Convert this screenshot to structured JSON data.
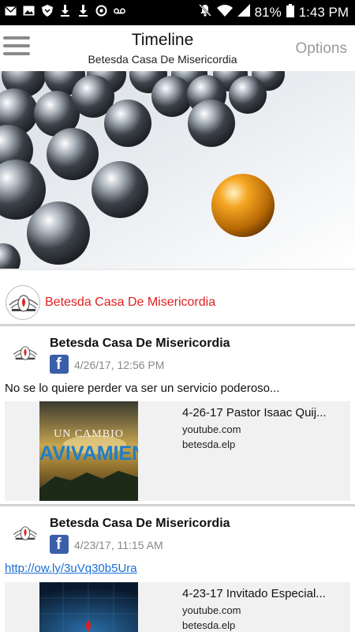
{
  "status_bar": {
    "battery": "81%",
    "time": "1:43 PM"
  },
  "header": {
    "title": "Timeline",
    "subtitle": "Betesda Casa De Misericordia",
    "options_label": "Options"
  },
  "channel": {
    "name": "Betesda Casa De Misericordia"
  },
  "posts": [
    {
      "author": "Betesda Casa De Misericordia",
      "source_icon": "facebook-icon",
      "date": "4/26/17, 12:56 PM",
      "text": "No se lo quiere perder va ser un servicio poderoso...",
      "card": {
        "title": "4-26-17 Pastor Isaac Quij...",
        "host": "youtube.com",
        "user": "betesda.elp",
        "thumb_text_top": "UN CAMBIO",
        "thumb_text_bottom": "AVIVAMIENTO"
      }
    },
    {
      "author": "Betesda Casa De Misericordia",
      "source_icon": "facebook-icon",
      "date": "4/23/17, 11:15 AM",
      "link": "http://ow.ly/3uVq30b5Ura",
      "card": {
        "title": "4-23-17 Invitado Especial...",
        "host": "youtube.com",
        "user": "betesda.elp"
      }
    }
  ],
  "colors": {
    "accent_red": "#e02020",
    "facebook_blue": "#3b5ea8",
    "link_blue": "#1a6fd6"
  }
}
